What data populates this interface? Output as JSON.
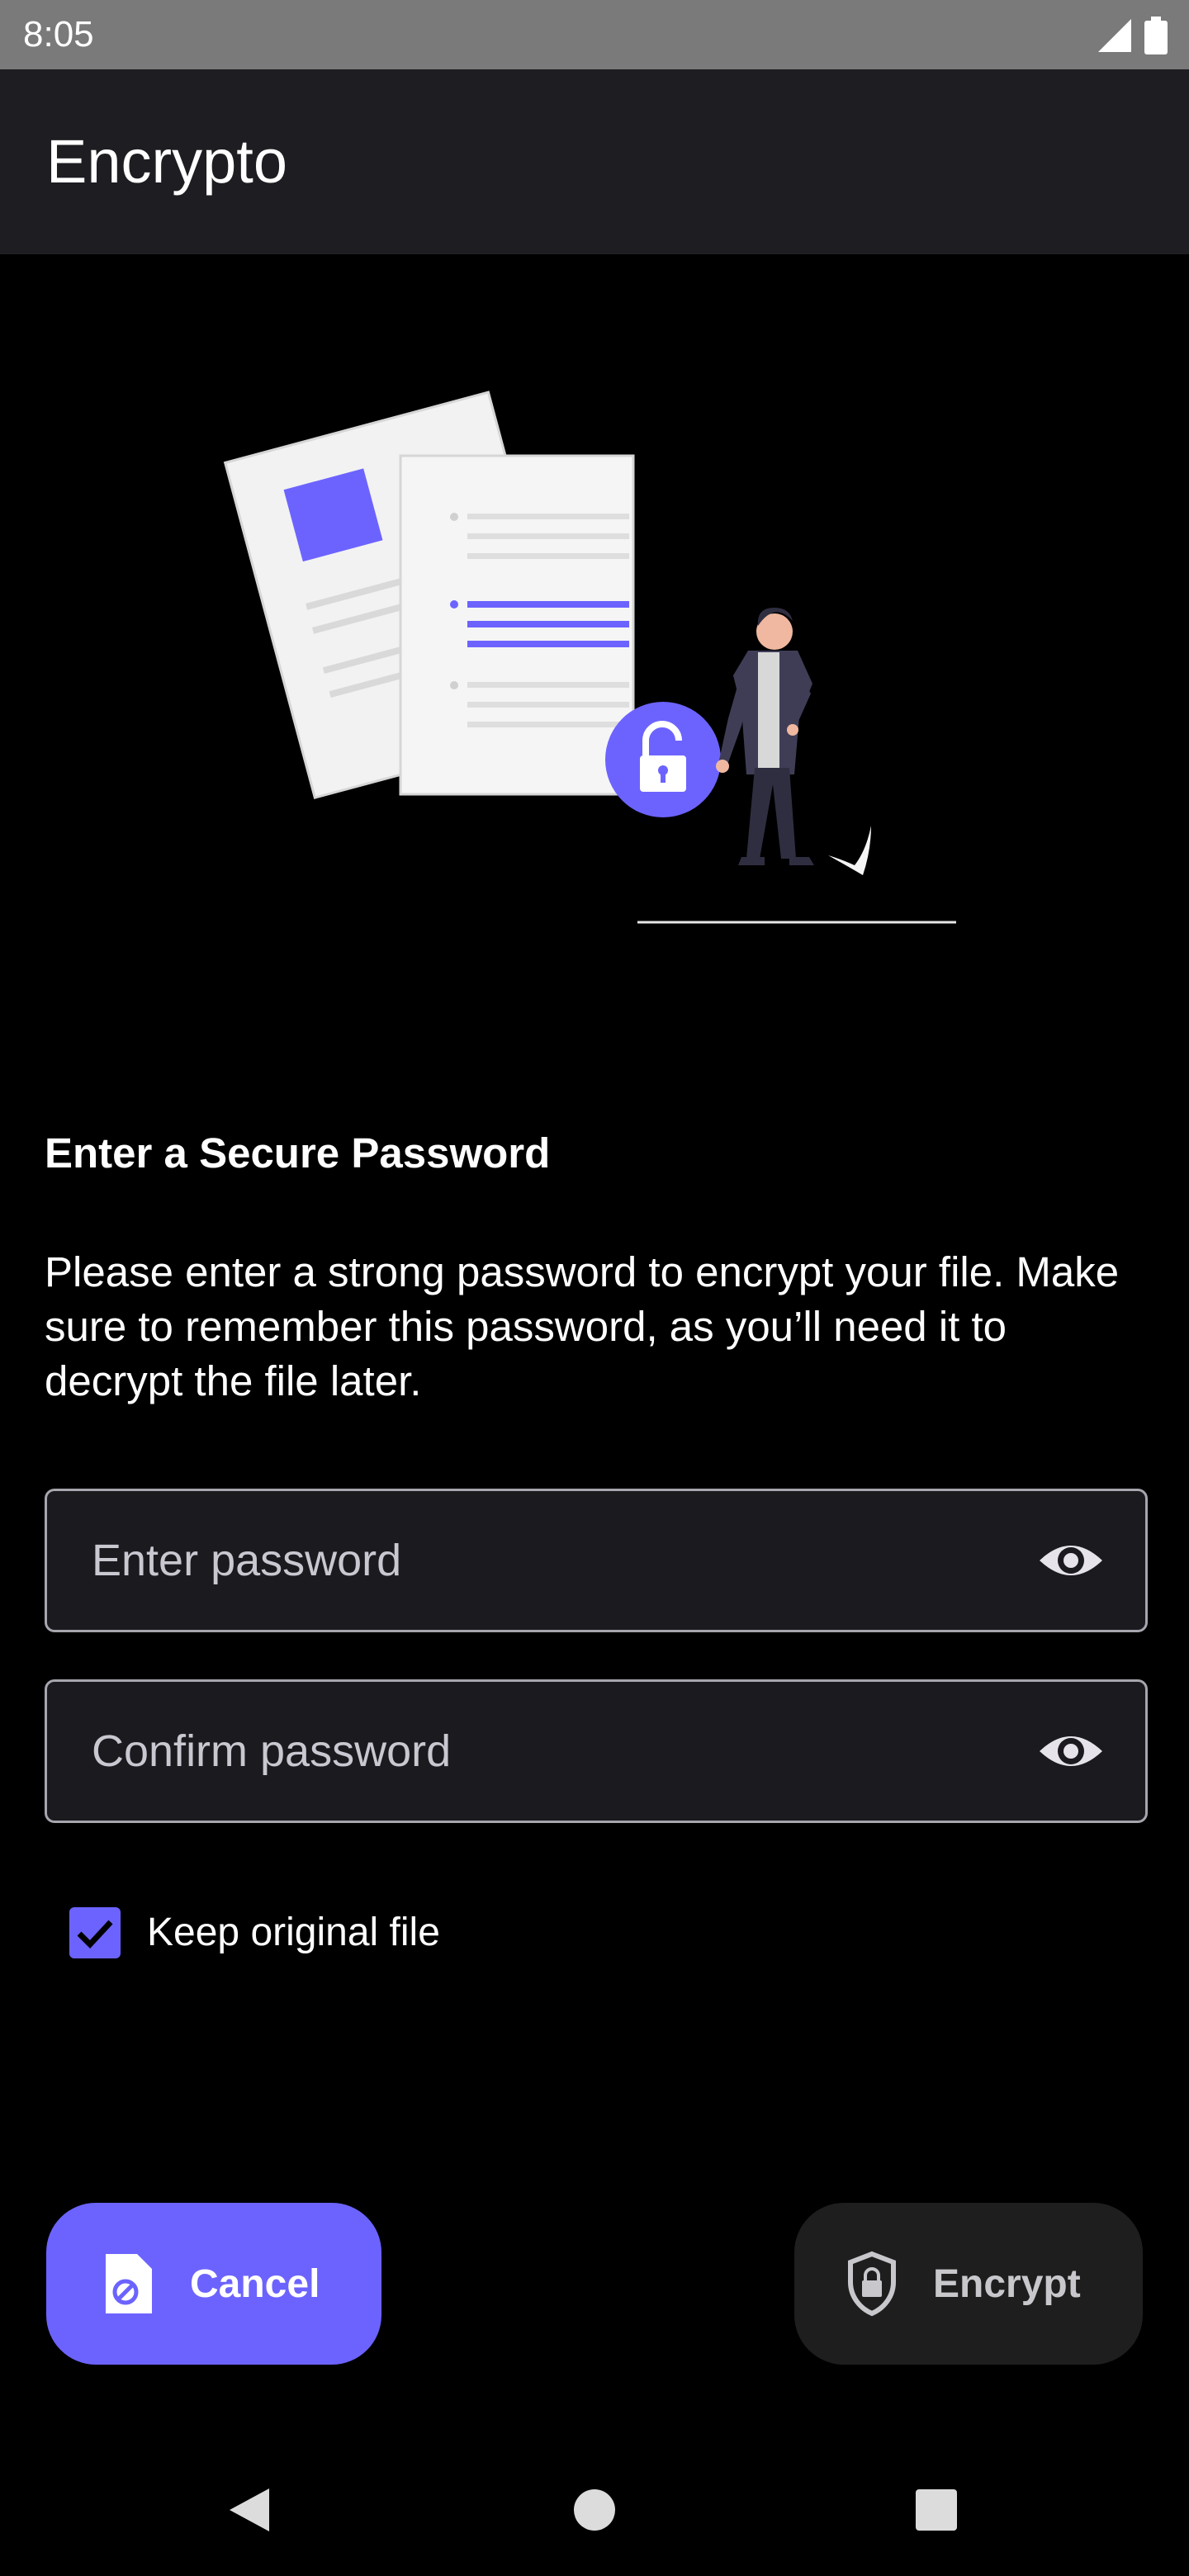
{
  "status_bar": {
    "time": "8:05",
    "icons": [
      "signal-icon",
      "battery-icon"
    ]
  },
  "app_bar": {
    "title": "Encrypto"
  },
  "illustration": {
    "name": "file-lock-person-illustration"
  },
  "content": {
    "heading": "Enter a Secure Password",
    "description": "Please enter a strong password to encrypt your file. Make sure to remember this password, as you’ll need it to decrypt the file later."
  },
  "fields": {
    "password": {
      "value": "",
      "placeholder": "Enter password",
      "toggle_icon": "eye-icon"
    },
    "confirm": {
      "value": "",
      "placeholder": "Confirm password",
      "toggle_icon": "eye-icon"
    }
  },
  "keep_original": {
    "label": "Keep original file",
    "checked": true
  },
  "buttons": {
    "cancel": {
      "label": "Cancel",
      "icon": "file-cancel-icon"
    },
    "encrypt": {
      "label": "Encrypt",
      "icon": "shield-lock-icon"
    }
  },
  "nav": {
    "buttons": [
      "back-icon",
      "home-icon",
      "recents-icon"
    ]
  },
  "colors": {
    "accent": "#6c63ff",
    "app_bar": "#1e1d22",
    "status_bar": "#7a7a7a",
    "background": "#000000",
    "field_background": "#1b1a1f",
    "field_border": "#a7a5ad",
    "encrypt_button": "#1e1e1e"
  }
}
